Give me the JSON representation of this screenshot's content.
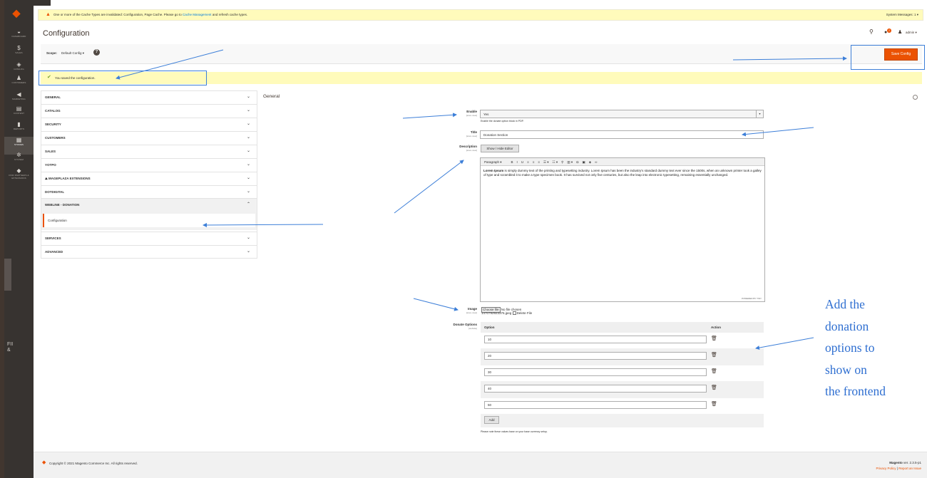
{
  "system_message": {
    "text_before_link": "One or more of the Cache Types are invalidated: Configuration, Page Cache. Please go to ",
    "link": "Cache Management",
    "text_after_link": " and refresh cache types.",
    "system_messages": "System Messages: 1"
  },
  "sidebar": {
    "items": [
      {
        "label": "DASHBOARD",
        "icon": "dashboard-icon",
        "glyph": "◒"
      },
      {
        "label": "SALES",
        "icon": "dollar-icon",
        "glyph": "$"
      },
      {
        "label": "CATALOG",
        "icon": "cube-icon",
        "glyph": "◈"
      },
      {
        "label": "CUSTOMERS",
        "icon": "person-icon",
        "glyph": "♟"
      },
      {
        "label": "MARKETING",
        "icon": "megaphone-icon",
        "glyph": "◀"
      },
      {
        "label": "CONTENT",
        "icon": "content-icon",
        "glyph": "▤"
      },
      {
        "label": "REPORTS",
        "icon": "bar-chart-icon",
        "glyph": "▮"
      },
      {
        "label": "STORES",
        "icon": "store-icon",
        "glyph": "▦"
      },
      {
        "label": "SYSTEM",
        "icon": "gear-icon",
        "glyph": "✲"
      },
      {
        "label": "FIND PARTNERS & EXTENSIONS",
        "icon": "extensions-icon",
        "glyph": "◆"
      }
    ],
    "ghost_text_1": "FII",
    "ghost_text_2": "&"
  },
  "header": {
    "title": "Configuration",
    "notifications_count": "2",
    "user_name": "admin ▾"
  },
  "scope": {
    "label": "Scope:",
    "value": "Default Config ▾",
    "help": "?"
  },
  "save_button": "Save Config",
  "success_message": "You saved the configuration.",
  "config_nav": {
    "items": [
      {
        "label": "GENERAL",
        "chev": "⌄"
      },
      {
        "label": "CATALOG",
        "chev": "⌄"
      },
      {
        "label": "SECURITY",
        "chev": "⌄"
      },
      {
        "label": "CUSTOMERS",
        "chev": "⌄"
      },
      {
        "label": "SALES",
        "chev": "⌄"
      },
      {
        "label": "YOTPO",
        "chev": "⌄"
      },
      {
        "label": "⛰ MAGEPLAZA EXTENSIONS",
        "chev": "⌄"
      },
      {
        "label": "DOTDIGITAL",
        "chev": "⌄"
      },
      {
        "label": "WEBLINE - DONATION",
        "chev": "⌃"
      }
    ],
    "sub_item": "Configuration",
    "after_items": [
      {
        "label": "SERVICES",
        "chev": "⌄"
      },
      {
        "label": "ADVANCED",
        "chev": "⌄"
      }
    ]
  },
  "section": {
    "title": "General",
    "fields": {
      "enable": {
        "label": "Enable",
        "scope": "[store view]",
        "value": "Yes",
        "note": "Enable the donate option block in PDP."
      },
      "title": {
        "label": "Title",
        "scope": "[store view]",
        "value": "Donation Section"
      },
      "description": {
        "label": "Description",
        "scope": "[store view]",
        "toggle_button": "Show / Hide Editor",
        "toolbar": [
          "Paragraph ▾",
          "B",
          "I",
          "U",
          "≡",
          "≡",
          "≡",
          "☰ ▾",
          "☷ ▾",
          "⚲",
          "▥ ▾",
          "Ω",
          "▣",
          "◈",
          "∞"
        ],
        "body_bold": "Lorem Ipsum",
        "body_rest": " is simply dummy text of the printing and typesetting industry. Lorem Ipsum has been the industry's standard dummy text ever since the 1500s, when an unknown printer took a galley of type and scrambled it to make a type specimen book. It has survived not only five centuries, but also the leap into electronic typesetting, remaining essentially unchanged.",
        "powered_by": "POWERED BY TINY"
      },
      "image": {
        "label": "Image",
        "scope": "[store view]",
        "choose_button": "Choose file",
        "no_file": "No file chosen",
        "filename": "1470792923376.jpeg",
        "delete_label": "Delete File"
      },
      "donate_options": {
        "label": "Donate Options",
        "scope": "[website]",
        "col_option": "Option",
        "col_action": "Action",
        "values": [
          "10",
          "20",
          "30",
          "40",
          "50"
        ],
        "add_button": "Add",
        "note": "Please note these values base on your base currency setup."
      }
    }
  },
  "annotation": {
    "lines": [
      "Add the",
      "donation",
      "options to",
      "show on",
      "the frontend"
    ]
  },
  "footer": {
    "copyright": "Copyright © 2021 Magento Commerce Inc. All rights reserved.",
    "brand": "Magento",
    "version": " ver. 2.3.5-p1",
    "privacy": "Privacy Policy",
    "separator": " | ",
    "report": "Report an Issue"
  },
  "colors": {
    "accent": "#eb5202",
    "sidebar": "#373330",
    "annotation": "#2f6fd1",
    "message_bg": "#fffbbb"
  }
}
